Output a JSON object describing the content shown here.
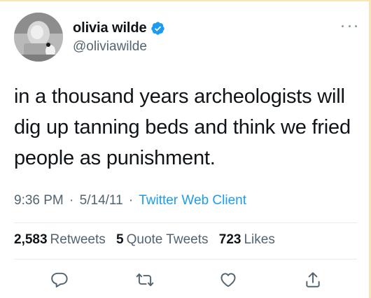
{
  "author": {
    "display_name": "olivia wilde",
    "handle": "@oliviawilde",
    "verified": true
  },
  "tweet": {
    "text": "in a thousand years archeologists will dig up tanning beds and think we fried people as punishment.",
    "time": "9:36 PM",
    "date": "5/14/11",
    "separator": "·",
    "source": "Twitter Web Client"
  },
  "stats": [
    {
      "count": "2,583",
      "label": "Retweets"
    },
    {
      "count": "5",
      "label": "Quote Tweets"
    },
    {
      "count": "723",
      "label": "Likes"
    }
  ],
  "icons": {
    "more": "more-dots-icon",
    "verified": "verified-badge-icon",
    "reply": "reply-icon",
    "retweet": "retweet-icon",
    "like": "like-icon",
    "share": "share-icon"
  },
  "colors": {
    "text": "#0f1419",
    "secondary": "#536471",
    "link": "#1d9bf0",
    "verified": "#1d9bf0",
    "divider": "#e6ecf0"
  }
}
